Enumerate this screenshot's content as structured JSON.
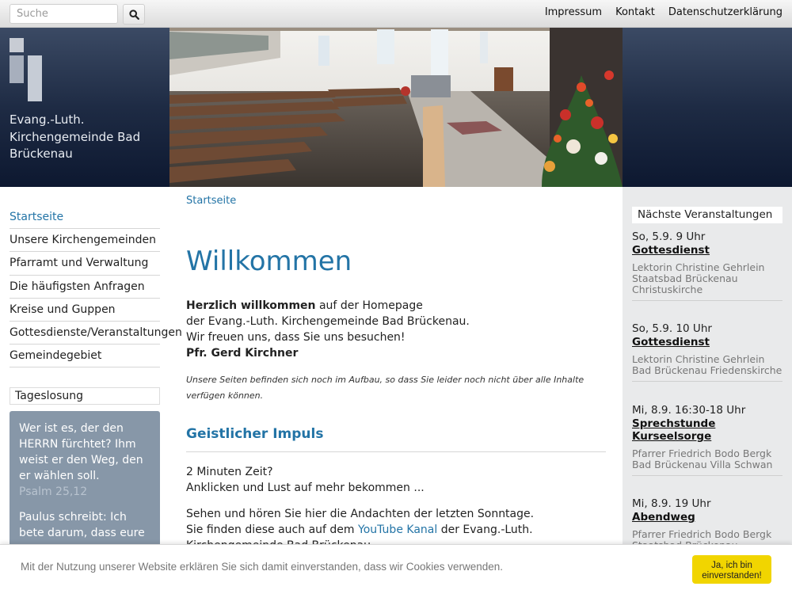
{
  "search": {
    "placeholder": "Suche",
    "icon": "search-icon"
  },
  "toplinks": [
    "Impressum",
    "Kontakt",
    "Datenschutzerklärung"
  ],
  "site_name": "Evang.-Luth. Kirchengemeinde Bad Brückenau",
  "nav": {
    "items": [
      "Startseite",
      "Unsere Kirchengemeinden",
      "Pfarramt und Verwaltung",
      "Die häufigsten Anfragen",
      "Kreise und Guppen",
      "Gottesdienste/Veranstaltungen",
      "Gemeindegebiet"
    ]
  },
  "tageslosung": {
    "title": "Tageslosung",
    "verse": "Wer ist es, der den HERRN fürchtet? Ihm weist er den Weg, den er wählen soll.",
    "ref": "Psalm 25,12",
    "second": "Paulus schreibt:  Ich bete darum, dass eure"
  },
  "main": {
    "breadcrumb": "Startseite",
    "title": "Willkommen",
    "intro_bold": "Herzlich willkommen",
    "intro_rest": " auf der Homepage",
    "intro_line2": "der Evang.-Luth. Kirchengemeinde Bad Brückenau.",
    "intro_line3": "Wir freuen uns, dass Sie uns besuchen!",
    "intro_sign": "Pfr. Gerd Kirchner",
    "note": "Unsere Seiten befinden sich noch im Aufbau, so dass Sie leider noch nicht über alle Inhalte verfügen können.",
    "impulse_title": "Geistlicher Impuls",
    "impulse_line1": "2 Minuten Zeit?",
    "impulse_line2": "Anklicken und Lust auf mehr bekommen ...",
    "impulse_line3": "Sehen und hören Sie hier die Andachten der letzten Sonntage.",
    "impulse_line4_a": "Sie finden diese auch auf dem ",
    "impulse_link": "YouTube Kanal",
    "impulse_line4_b": " der Evang.-Luth.",
    "impulse_line5": "Kirchengemeinde Bad Brückenau."
  },
  "events": {
    "title": "Nächste Veranstaltungen",
    "items": [
      {
        "date": "So, 5.9. 9 Uhr",
        "title": "Gottesdienst",
        "person": "Lektorin Christine Gehrlein",
        "place": "Staatsbad Brückenau Christuskirche"
      },
      {
        "date": "So, 5.9. 10 Uhr",
        "title": "Gottesdienst",
        "person": "Lektorin Christine Gehrlein",
        "place": "Bad Brückenau Friedenskirche"
      },
      {
        "date": "Mi, 8.9. 16:30-18 Uhr",
        "title": "Sprechstunde Kurseelsorge",
        "person": "Pfarrer Friedrich Bodo Bergk",
        "place": "Bad Brückenau Villa Schwan"
      },
      {
        "date": "Mi, 8.9. 19 Uhr",
        "title": "Abendweg",
        "person": "Pfarrer Friedrich Bodo Bergk",
        "place": "Staatsbad Brückenau"
      }
    ]
  },
  "cookie": {
    "text": "Mit der Nutzung unserer Website erklären Sie sich damit einverstanden, dass wir Cookies verwenden.",
    "button": "Ja, ich bin einverstanden!"
  },
  "colors": {
    "link": "#2374a6",
    "header_dark": "#1e2b44",
    "losung_bg": "#8797a8",
    "cookie_button": "#f1d500"
  }
}
